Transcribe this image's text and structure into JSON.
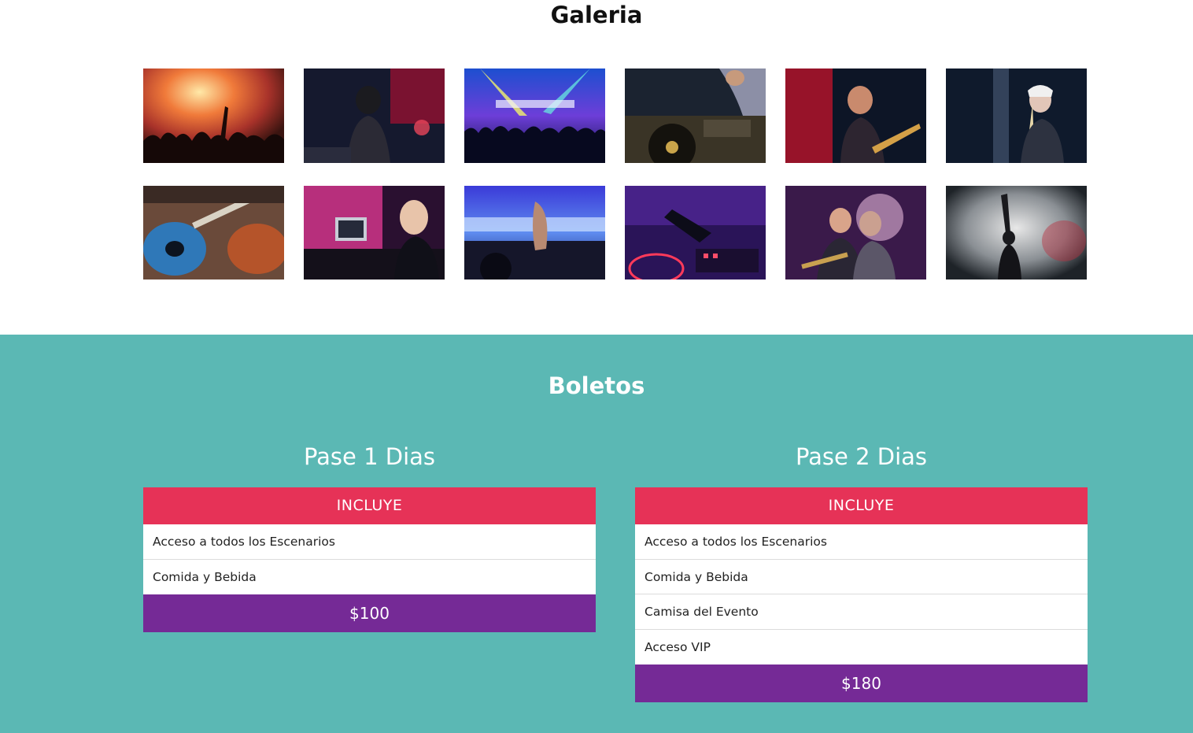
{
  "gallery": {
    "title": "Galeria",
    "images": [
      {
        "icon": "concert-crowd-photo"
      },
      {
        "icon": "singer-on-stage-photo"
      },
      {
        "icon": "club-crowd-lights-photo"
      },
      {
        "icon": "dj-turntables-photo"
      },
      {
        "icon": "guitarist-singing-photo"
      },
      {
        "icon": "female-dj-photo"
      },
      {
        "icon": "guitars-closeup-photo"
      },
      {
        "icon": "dj-laptop-photo"
      },
      {
        "icon": "dj-mixer-hands-photo"
      },
      {
        "icon": "dj-hand-neon-photo"
      },
      {
        "icon": "band-singers-photo"
      },
      {
        "icon": "performer-smoke-photo"
      }
    ]
  },
  "tickets": {
    "title": "Boletos",
    "plans": [
      {
        "name": "Pase 1 Dias",
        "header": "INCLUYE",
        "items": [
          "Acceso a todos los Escenarios",
          "Comida y Bebida"
        ],
        "price": "$100"
      },
      {
        "name": "Pase 2 Dias",
        "header": "INCLUYE",
        "items": [
          "Acceso a todos los Escenarios",
          "Comida y Bebida",
          "Camisa del Evento",
          "Acceso VIP"
        ],
        "price": "$180"
      }
    ]
  },
  "colors": {
    "teal": "#5bb8b4",
    "pink": "#e63257",
    "purple": "#752a96"
  }
}
